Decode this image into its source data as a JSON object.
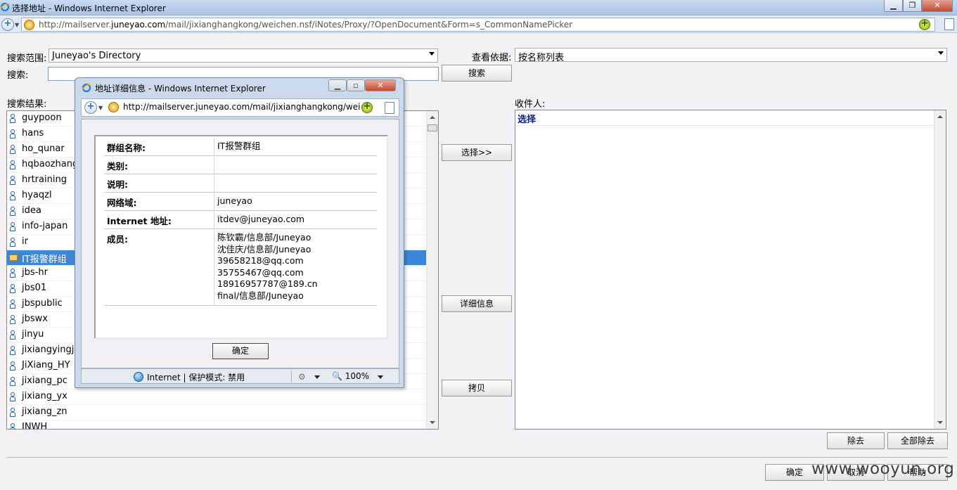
{
  "window": {
    "title": "选择地址 - Windows Internet Explorer",
    "url_prefix": "http://mailserver.",
    "url_domain": "juneyao.com",
    "url_suffix": "/mail/jixianghangkong/weichen.nsf/iNotes/Proxy/?OpenDocument&Form=s_CommonNamePicker",
    "minimize_icon": "minimize-icon",
    "maximize_icon": "maximize-icon",
    "close_icon": "close-icon"
  },
  "form": {
    "scope_label": "搜索范围:",
    "scope_value": "Juneyao's Directory",
    "view_label": "查看依据:",
    "view_value": "按名称列表",
    "search_label": "搜索:",
    "search_value": "",
    "search_button": "搜索",
    "results_label": "搜索结果:",
    "recipients_label": "收件人:"
  },
  "results": [
    {
      "name": "guypoon",
      "icon": "person-icon"
    },
    {
      "name": "hans",
      "icon": "person-icon"
    },
    {
      "name": "ho_qunar",
      "icon": "person-icon"
    },
    {
      "name": "hqbaozhang",
      "icon": "person-icon"
    },
    {
      "name": "hrtraining",
      "icon": "person-icon"
    },
    {
      "name": "hyaqzl",
      "icon": "person-icon"
    },
    {
      "name": "idea",
      "icon": "person-icon"
    },
    {
      "name": "info-japan",
      "icon": "person-icon"
    },
    {
      "name": "ir",
      "icon": "person-icon"
    },
    {
      "name": "IT报警群组",
      "icon": "group-icon",
      "selected": true
    },
    {
      "name": "jbs-hr",
      "icon": "person-icon"
    },
    {
      "name": "jbs01",
      "icon": "person-icon"
    },
    {
      "name": "jbspublic",
      "icon": "person-icon"
    },
    {
      "name": "jbswx",
      "icon": "person-icon"
    },
    {
      "name": "jinyu",
      "icon": "person-icon"
    },
    {
      "name": "jixiangyingji",
      "icon": "person-icon"
    },
    {
      "name": "JiXiang_HY",
      "icon": "person-icon"
    },
    {
      "name": "jixiang_pc",
      "icon": "person-icon"
    },
    {
      "name": "jixiang_yx",
      "icon": "person-icon"
    },
    {
      "name": "jixiang_zn",
      "icon": "person-icon"
    },
    {
      "name": "JNWH",
      "icon": "person-icon"
    }
  ],
  "actions": {
    "select_button": "选择>>",
    "details_button": "详细信息",
    "copy_button": "拷贝",
    "remove_button": "除去",
    "remove_all_button": "全部除去",
    "ok_button": "确定",
    "cancel_button": "取消",
    "help_button": "帮助"
  },
  "recipients": [
    {
      "name": "选择"
    }
  ],
  "watermark": "www.wooyun.org",
  "dialog": {
    "title": "地址详细信息 - Windows Internet Explorer",
    "url": "http://mailserver.juneyao.com/mail/jixianghangkong/weichen",
    "ok_button": "确定",
    "status_text": "Internet | 保护模式: 禁用",
    "zoom": "100%",
    "rows": [
      {
        "key": "群组名称:",
        "value": "IT报警群组"
      },
      {
        "key": "类别:",
        "value": ""
      },
      {
        "key": "说明:",
        "value": ""
      },
      {
        "key": "网络域:",
        "value": "juneyao"
      },
      {
        "key": "Internet 地址:",
        "value": "itdev@juneyao.com"
      }
    ],
    "members_label": "成员:",
    "members": [
      "陈钦霸/信息部/Juneyao",
      "沈佳庆/信息部/Juneyao",
      "39658218@qq.com",
      "35755467@qq.com",
      "18916957787@189.cn",
      "final/信息部/Juneyao"
    ]
  }
}
